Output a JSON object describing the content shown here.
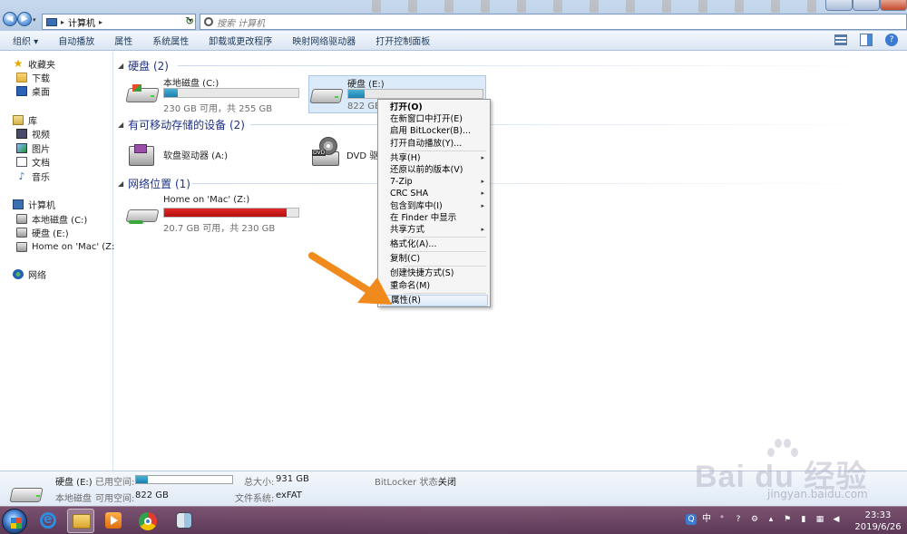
{
  "address": {
    "path_root_icon": "computer-icon",
    "path_item": "计算机",
    "search_placeholder": "搜索 计算机"
  },
  "toolbar": {
    "items": [
      "组织 ▾",
      "自动播放",
      "属性",
      "系统属性",
      "卸载或更改程序",
      "映射网络驱动器",
      "打开控制面板"
    ]
  },
  "sidebar": {
    "favorites": [
      "收藏夹",
      "下载",
      "桌面"
    ],
    "libraries": [
      "库",
      "视频",
      "图片",
      "文档",
      "音乐"
    ],
    "computer": [
      "计算机",
      "本地磁盘 (C:)",
      "硬盘 (E:)",
      "Home on 'Mac' (Z:)"
    ],
    "network": "网络"
  },
  "groups": {
    "hdd": "硬盘 (2)",
    "removable": "有可移动存储的设备 (2)",
    "network": "网络位置 (1)"
  },
  "drives": {
    "c": {
      "name": "本地磁盘 (C:)",
      "info": "230 GB 可用，共 255 GB",
      "used_fraction": 0.1
    },
    "e": {
      "name": "硬盘 (E:)",
      "info": "822 GB",
      "used_fraction": 0.12
    },
    "a": {
      "name": "软盘驱动器 (A:)"
    },
    "dvd": {
      "name": "DVD 驱"
    },
    "z": {
      "name": "Home on 'Mac' (Z:)",
      "info": "20.7 GB 可用，共 230 GB",
      "used_fraction": 0.91
    }
  },
  "context_menu": {
    "items": [
      {
        "label": "打开(O)",
        "bold": true
      },
      {
        "label": "在新窗口中打开(E)"
      },
      {
        "label": "启用 BitLocker(B)..."
      },
      {
        "label": "打开自动播放(Y)..."
      },
      {
        "sep": true
      },
      {
        "label": "共享(H)",
        "sub": true
      },
      {
        "label": "还原以前的版本(V)"
      },
      {
        "label": "7-Zip",
        "sub": true
      },
      {
        "label": "CRC SHA",
        "sub": true
      },
      {
        "label": "包含到库中(I)",
        "sub": true
      },
      {
        "label": "在 Finder 中显示"
      },
      {
        "label": "共享方式",
        "sub": true
      },
      {
        "sep": true
      },
      {
        "label": "格式化(A)..."
      },
      {
        "sep": true
      },
      {
        "label": "复制(C)"
      },
      {
        "sep": true
      },
      {
        "label": "创建快捷方式(S)"
      },
      {
        "label": "重命名(M)"
      },
      {
        "sep": true
      },
      {
        "label": "属性(R)",
        "hover": true
      }
    ]
  },
  "details": {
    "name": "硬盘 (E:)",
    "type": "本地磁盘",
    "used_label": "已用空间:",
    "free_label": "可用空间:",
    "free_value": "822 GB",
    "total_label": "总大小:",
    "total_value": "931 GB",
    "fs_label": "文件系统:",
    "fs_value": "exFAT",
    "bitlocker_label": "BitLocker 状态:",
    "bitlocker_value": "关闭",
    "used_fraction": 0.12
  },
  "taskbar": {
    "tray_ime": "中",
    "time": "23:33",
    "date": "2019/6/26"
  },
  "watermark": {
    "brand": "Bai du 经验",
    "sub": "jingyan.baidu.com"
  },
  "colors": {
    "accent": "#1e3287",
    "bar_normal": "#1a7fb0",
    "bar_full": "#c81414",
    "arrow": "#f08a1c"
  }
}
